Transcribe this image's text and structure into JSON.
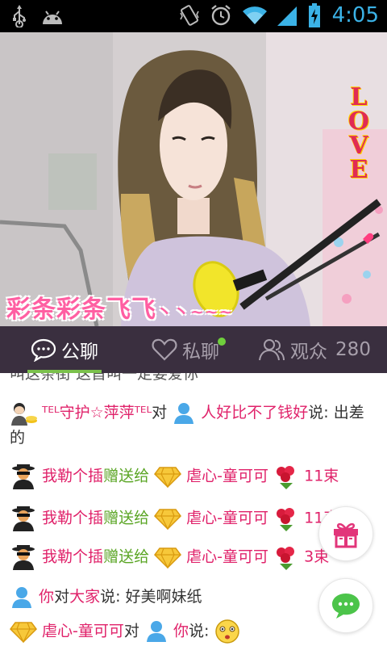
{
  "status_bar": {
    "time": "4:05",
    "icons": [
      "usb-icon",
      "android-icon",
      "vibrate-icon",
      "alarm-icon",
      "wifi-icon",
      "signal-icon",
      "battery-icon"
    ]
  },
  "video": {
    "caption": "彩条彩条飞飞",
    "caption_tail": "丶丶~~~",
    "love_letters": [
      "L",
      "O",
      "V",
      "E"
    ]
  },
  "tabs": [
    {
      "label": "公聊",
      "icon": "chat-bubble-icon",
      "active": true
    },
    {
      "label": "私聊",
      "icon": "heart-icon",
      "active": false,
      "has_notification_dot": true
    },
    {
      "label": "观众",
      "icon": "audience-icon",
      "active": false,
      "count": "280"
    }
  ],
  "chat": {
    "cut_line": "叫这条街 这首叫一定要爱你",
    "messages": [
      {
        "type": "message",
        "from": "ᵀᴱᴸ守护☆萍萍ᵀᴱᴸ",
        "connector": "对",
        "to": "人好比不了钱好",
        "say": "说: 出差的"
      },
      {
        "type": "gift",
        "from": "我勒个插",
        "action": "赠送给",
        "to": "虐心-童可可",
        "amount": "11束"
      },
      {
        "type": "gift",
        "from": "我勒个插",
        "action": "赠送给",
        "to": "虐心-童可可",
        "amount": "11束"
      },
      {
        "type": "gift",
        "from": "我勒个插",
        "action": "赠送给",
        "to": "虐心-童可可",
        "amount": "3束"
      },
      {
        "type": "message",
        "from": "你",
        "connector": "对",
        "to": "大家",
        "say": "说: 好美啊妹纸"
      },
      {
        "type": "message",
        "from": "虐心-童可可",
        "connector": "对",
        "to": "你",
        "say": "说:"
      }
    ]
  },
  "colors": {
    "tab_bar_bg": "#3a2f3f",
    "tab_active_underline": "#7bc14c",
    "name_pink": "#e0226a",
    "gift_green": "#5aa524",
    "clock_blue": "#3bb2e6"
  }
}
